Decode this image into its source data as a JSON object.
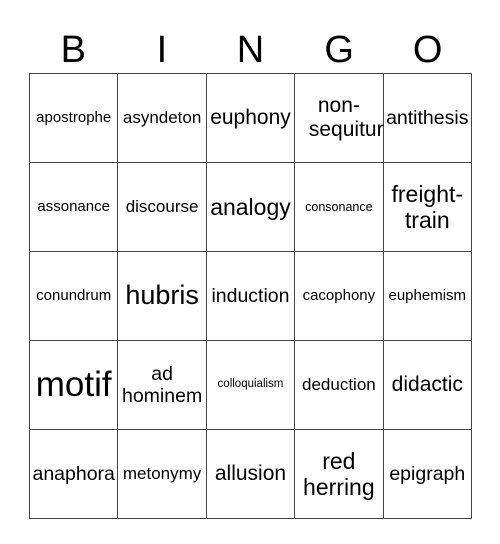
{
  "header": {
    "letters": [
      "B",
      "I",
      "N",
      "G",
      "O"
    ]
  },
  "card": {
    "rows": [
      [
        "apostrophe",
        "asyndeton",
        "euphony",
        "non-sequitur",
        "antithesis"
      ],
      [
        "assonance",
        "discourse",
        "analogy",
        "consonance",
        "freight-train"
      ],
      [
        "conundrum",
        "hubris",
        "induction",
        "cacophony",
        "euphemism"
      ],
      [
        "motif",
        "ad hominem",
        "colloquialism",
        "deduction",
        "didactic"
      ],
      [
        "anaphora",
        "metonymy",
        "allusion",
        "red herring",
        "epigraph"
      ]
    ]
  }
}
